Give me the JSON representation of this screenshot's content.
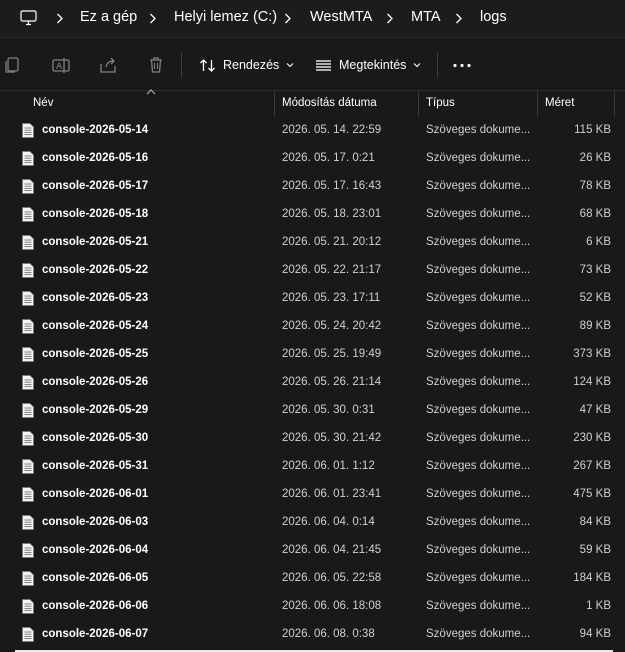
{
  "addressbar": {
    "icon": "computer-monitor-icon",
    "crumbs": [
      "Ez a gép",
      "Helyi lemez (C:)",
      "WestMTA",
      "MTA",
      "logs"
    ]
  },
  "toolbar": {
    "icons": [
      "copy-icon",
      "rename-icon",
      "share-icon",
      "delete-icon"
    ],
    "sort_label": "Rendezés",
    "view_label": "Megtekintés",
    "more_icon": "more-icon"
  },
  "columns": {
    "name": "Név",
    "modified": "Módosítás dátuma",
    "type": "Típus",
    "size": "Méret"
  },
  "files": [
    {
      "name": "console-2026-05-14",
      "date": "2026. 05. 14. 22:59",
      "type": "Szöveges dokume...",
      "size": "115 KB"
    },
    {
      "name": "console-2026-05-16",
      "date": "2026. 05. 17. 0:21",
      "type": "Szöveges dokume...",
      "size": "26 KB"
    },
    {
      "name": "console-2026-05-17",
      "date": "2026. 05. 17. 16:43",
      "type": "Szöveges dokume...",
      "size": "78 KB"
    },
    {
      "name": "console-2026-05-18",
      "date": "2026. 05. 18. 23:01",
      "type": "Szöveges dokume...",
      "size": "68 KB"
    },
    {
      "name": "console-2026-05-21",
      "date": "2026. 05. 21. 20:12",
      "type": "Szöveges dokume...",
      "size": "6 KB"
    },
    {
      "name": "console-2026-05-22",
      "date": "2026. 05. 22. 21:17",
      "type": "Szöveges dokume...",
      "size": "73 KB"
    },
    {
      "name": "console-2026-05-23",
      "date": "2026. 05. 23. 17:11",
      "type": "Szöveges dokume...",
      "size": "52 KB"
    },
    {
      "name": "console-2026-05-24",
      "date": "2026. 05. 24. 20:42",
      "type": "Szöveges dokume...",
      "size": "89 KB"
    },
    {
      "name": "console-2026-05-25",
      "date": "2026. 05. 25. 19:49",
      "type": "Szöveges dokume...",
      "size": "373 KB"
    },
    {
      "name": "console-2026-05-26",
      "date": "2026. 05. 26. 21:14",
      "type": "Szöveges dokume...",
      "size": "124 KB"
    },
    {
      "name": "console-2026-05-29",
      "date": "2026. 05. 30. 0:31",
      "type": "Szöveges dokume...",
      "size": "47 KB"
    },
    {
      "name": "console-2026-05-30",
      "date": "2026. 05. 30. 21:42",
      "type": "Szöveges dokume...",
      "size": "230 KB"
    },
    {
      "name": "console-2026-05-31",
      "date": "2026. 06. 01. 1:12",
      "type": "Szöveges dokume...",
      "size": "267 KB"
    },
    {
      "name": "console-2026-06-01",
      "date": "2026. 06. 01. 23:41",
      "type": "Szöveges dokume...",
      "size": "475 KB"
    },
    {
      "name": "console-2026-06-03",
      "date": "2026. 06. 04. 0:14",
      "type": "Szöveges dokume...",
      "size": "84 KB"
    },
    {
      "name": "console-2026-06-04",
      "date": "2026. 06. 04. 21:45",
      "type": "Szöveges dokume...",
      "size": "59 KB"
    },
    {
      "name": "console-2026-06-05",
      "date": "2026. 06. 05. 22:58",
      "type": "Szöveges dokume...",
      "size": "184 KB"
    },
    {
      "name": "console-2026-06-06",
      "date": "2026. 06. 06. 18:08",
      "type": "Szöveges dokume...",
      "size": "1 KB"
    },
    {
      "name": "console-2026-06-07",
      "date": "2026. 06. 08. 0:38",
      "type": "Szöveges dokume...",
      "size": "94 KB"
    }
  ],
  "file_icon": "text-document-icon"
}
